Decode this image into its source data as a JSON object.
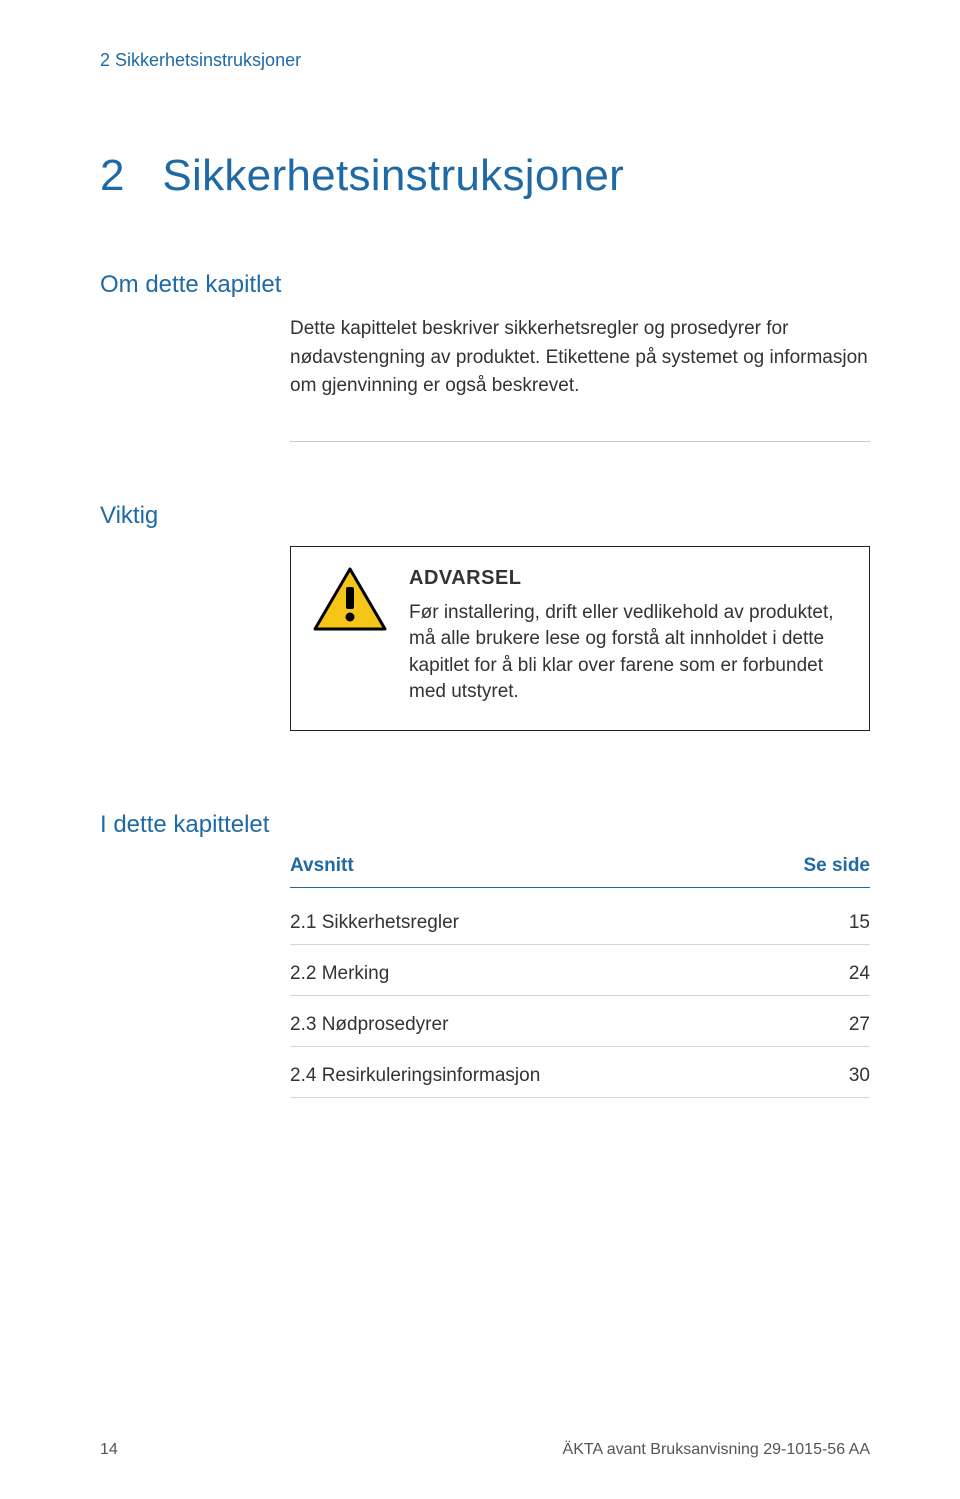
{
  "breadcrumb": "2 Sikkerhetsinstruksjoner",
  "chapter": {
    "number": "2",
    "title": "Sikkerhetsinstruksjoner"
  },
  "sec1": {
    "heading": "Om dette kapitlet",
    "body": "Dette kapittelet beskriver sikkerhetsregler og prosedyrer for nødavstengning av produktet. Etikettene på systemet og informasjon om gjenvinning er også beskrevet."
  },
  "sec2": {
    "heading": "Viktig",
    "warning": {
      "title": "ADVARSEL",
      "body": "Før installering, drift eller vedlikehold av produktet, må alle brukere lese og forstå alt innholdet i dette kapitlet for å bli klar over farene som er forbundet med utstyret."
    }
  },
  "toc": {
    "heading": "I dette kapittelet",
    "col_section": "Avsnitt",
    "col_page": "Se side",
    "rows": [
      {
        "label": "2.1 Sikkerhetsregler",
        "page": "15"
      },
      {
        "label": "2.2 Merking",
        "page": "24"
      },
      {
        "label": "2.3 Nødprosedyrer",
        "page": "27"
      },
      {
        "label": "2.4 Resirkuleringsinformasjon",
        "page": "30"
      }
    ]
  },
  "footer": {
    "page_number": "14",
    "doc_id": "ÄKTA avant Bruksanvisning 29-1015-56 AA"
  }
}
